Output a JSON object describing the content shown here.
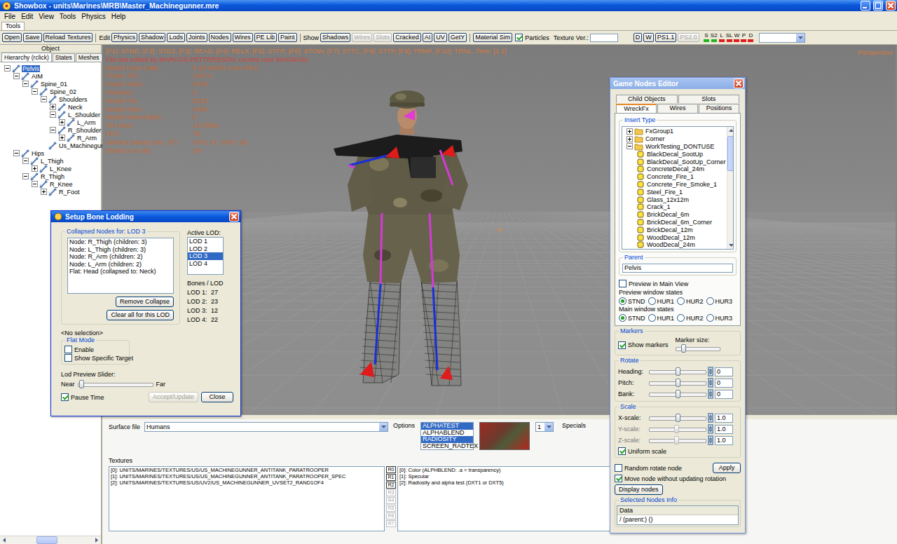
{
  "window": {
    "title": "Showbox - units\\Marines\\MRB\\Master_Machinegunner.mre"
  },
  "menu": [
    "File",
    "Edit",
    "View",
    "Tools",
    "Physics",
    "Help"
  ],
  "ribbon_tabs": [
    {
      "label": "Tools",
      "selected": true
    }
  ],
  "toolbar": {
    "file_buttons": [
      "Open",
      "Save",
      "Reload Textures"
    ],
    "edit_label": "Edit",
    "edit_buttons": [
      "Physics",
      "Shadow",
      "Lods",
      "Joints",
      "Nodes",
      "Wires",
      "PE Lib",
      "Paint"
    ],
    "show_label": "Show",
    "show_buttons": [
      {
        "label": "Shadows",
        "disabled": false
      },
      {
        "label": "Wires",
        "disabled": true
      },
      {
        "label": "Slots",
        "disabled": true
      },
      {
        "label": "Cracked",
        "disabled": false
      },
      {
        "label": "AI",
        "disabled": false
      },
      {
        "label": "UV",
        "disabled": false
      },
      {
        "label": "GetY",
        "disabled": false
      }
    ],
    "material_button": "Material Sim",
    "particles": {
      "label": "Particles",
      "checked": true
    },
    "texture_label": "Texture Ver.:",
    "shader_buttons": [
      {
        "label": "D",
        "disabled": false
      },
      {
        "label": "W",
        "disabled": false
      },
      {
        "label": "PS1.1",
        "disabled": false
      },
      {
        "label": "PS2.0",
        "disabled": true
      }
    ],
    "indicators": [
      {
        "label": "S",
        "color": "#1fb51f"
      },
      {
        "label": "S2",
        "color": "#1fb51f"
      },
      {
        "label": "L",
        "color": "#e01b1b"
      },
      {
        "label": "SL",
        "color": "#e01b1b"
      },
      {
        "label": "W",
        "color": "#e01b1b"
      },
      {
        "label": "P",
        "color": "#e01b1b"
      },
      {
        "label": "D",
        "color": "#e01b1b"
      }
    ]
  },
  "left_panel": {
    "header": "Object",
    "tabs": [
      {
        "label": "Hierarchy (rclick)",
        "selected": true
      },
      {
        "label": "States",
        "selected": false
      },
      {
        "label": "Meshes",
        "selected": false
      }
    ],
    "tree": [
      {
        "label": "Pelvis",
        "depth": 0,
        "kind": "node",
        "expanded": true,
        "selected": true
      },
      {
        "label": "AIM",
        "depth": 1,
        "kind": "node",
        "expanded": true,
        "selected": false
      },
      {
        "label": "Spine_01",
        "depth": 2,
        "kind": "node",
        "expanded": true,
        "selected": false
      },
      {
        "label": "Spine_02",
        "depth": 3,
        "kind": "node",
        "expanded": true,
        "selected": false
      },
      {
        "label": "Shoulders",
        "depth": 4,
        "kind": "node",
        "expanded": true,
        "selected": false
      },
      {
        "label": "Neck",
        "depth": 5,
        "kind": "node",
        "expanded": false,
        "selected": false
      },
      {
        "label": "L_Shoulder",
        "depth": 5,
        "kind": "node",
        "expanded": true,
        "selected": false
      },
      {
        "label": "L_Arm",
        "depth": 6,
        "kind": "node",
        "expanded": false,
        "selected": false
      },
      {
        "label": "R_Shoulder",
        "depth": 5,
        "kind": "node",
        "expanded": true,
        "selected": false
      },
      {
        "label": "R_Arm",
        "depth": 6,
        "kind": "node",
        "expanded": false,
        "selected": false
      },
      {
        "label": "Us_Machinegunner",
        "depth": 4,
        "kind": "leaf",
        "selected": false
      },
      {
        "label": "Hips",
        "depth": 1,
        "kind": "node",
        "expanded": true,
        "selected": false
      },
      {
        "label": "L_Thigh",
        "depth": 2,
        "kind": "node",
        "expanded": true,
        "selected": false
      },
      {
        "label": "L_Knee",
        "depth": 3,
        "kind": "node",
        "expanded": false,
        "selected": false
      },
      {
        "label": "R_Thigh",
        "depth": 2,
        "kind": "node",
        "expanded": true,
        "selected": false
      },
      {
        "label": "R_Knee",
        "depth": 3,
        "kind": "node",
        "expanded": true,
        "selected": false
      },
      {
        "label": "R_Foot",
        "depth": 4,
        "kind": "node",
        "expanded": false,
        "selected": false
      }
    ]
  },
  "viewport": {
    "keys_line": "[F1]: STND, [F2]: STD2, [F3]: READ, [F4]: RELX, [F5]: STFR, [F6]: STOW, [F7]: STTC, [F8]: STTP, [F9]: TRNR, [F10]: TRNL, Time: [1.2]",
    "edit_line": "File last edited by MARCUS PETTERSSON, current user MAGNUSL",
    "stats": [
      {
        "label": "Model Draw Calls:",
        "value": "5 (of which 0 are PEs)"
      },
      {
        "label": "Frame Tris:",
        "value": "10674"
      },
      {
        "label": "Frame Verts:",
        "value": "9780"
      },
      {
        "label": "Particles:",
        "value": "0"
      },
      {
        "label": "Model Tris:",
        "value": "5203"
      },
      {
        "label": "Model Verts:",
        "value": "4430"
      },
      {
        "label": "Model active lights:",
        "value": "0"
      },
      {
        "label": "Tex Mem:",
        "value": "12730kb"
      },
      {
        "label": "FPS:",
        "value": "78"
      },
      {
        "label": "Joints & Bones (tot.: 27):",
        "value": "CPU: 27, GPU: 26"
      },
      {
        "label": "Distance to obj:",
        "value": "3m"
      }
    ],
    "camera": "Perspective"
  },
  "bottom_panel": {
    "surface_label": "Surface file",
    "surface_value": "Humans",
    "options_label": "Options",
    "options": [
      {
        "label": "ALPHATEST",
        "selected": true
      },
      {
        "label": "ALPHABLEND",
        "selected": false
      },
      {
        "label": "RADIOSITY",
        "selected": true
      },
      {
        "label": "SCREEN_RADTEX",
        "selected": false
      }
    ],
    "lod_value": "1",
    "specials_label": "Specials",
    "textures_label": "Textures",
    "textures": [
      "[0]: UNITS/MARINES/TEXTURES/US/US_MACHINEGUNNER_ANTITANK_PARATROOPER",
      "[1]: UNITS/MARINES/TEXTURES/US/US_MACHINEGUNNER_ANTITANK_PARATROOPER_SPEC",
      "[2]: UNITS/MARINES/TEXTURES/US/UV2/US_MACHINEGUNNER_UVSET2_RAND1OF4"
    ],
    "slot_buttons": [
      {
        "label": "R0",
        "disabled": false
      },
      {
        "label": "R1",
        "disabled": false
      },
      {
        "label": "R2",
        "disabled": false
      },
      {
        "label": "R3",
        "disabled": true
      },
      {
        "label": "R4",
        "disabled": true
      },
      {
        "label": "R5",
        "disabled": true
      },
      {
        "label": "R6",
        "disabled": true
      },
      {
        "label": "R7",
        "disabled": true
      }
    ],
    "slot_descriptions": [
      "[0]: Color (ALPHBLEND: .a = transparency)",
      "[1]: Specular",
      "[2]: Radiosity and alpha test (DXT1 or DXT5)"
    ]
  },
  "bone_lodding": {
    "title": "Setup Bone Lodding",
    "collapsed_label": "Collapsed Nodes for: LOD 3",
    "collapsed_nodes": [
      "Node: R_Thigh (children: 3)",
      "Node: L_Thigh (children: 3)",
      "Node: R_Arm (children: 2)",
      "Node: L_Arm (children: 2)",
      "Flat: Head (collapsed to: Neck)"
    ],
    "remove_button": "Remove Collapse",
    "clear_button": "Clear all for this LOD",
    "active_lod_label": "Active LOD:",
    "lods": [
      {
        "label": "LOD 1",
        "selected": false
      },
      {
        "label": "LOD 2",
        "selected": false
      },
      {
        "label": "LOD 3",
        "selected": true
      },
      {
        "label": "LOD 4",
        "selected": false
      }
    ],
    "bones_label": "Bones / LOD",
    "bones": [
      {
        "label": "LOD 1:",
        "value": "27"
      },
      {
        "label": "LOD 2:",
        "value": "23"
      },
      {
        "label": "LOD 3:",
        "value": "12"
      },
      {
        "label": "LOD 4:",
        "value": "22"
      }
    ],
    "selection_text": "<No selection>",
    "flat_mode_label": "Flat Mode",
    "flat_enable": {
      "label": "Enable",
      "checked": false
    },
    "flat_target": {
      "label": "Show Specific Target",
      "checked": false
    },
    "slider_label": "Lod Preview Slider:",
    "near_label": "Near",
    "far_label": "Far",
    "slider_level": 0.02,
    "pause_time": {
      "label": "Pause Time",
      "checked": true
    },
    "accept_button": {
      "label": "Accept/Update",
      "disabled": true
    },
    "close_button": "Close"
  },
  "nodes_editor": {
    "title": "Game Nodes Editor",
    "tab_rows": [
      [
        {
          "label": "Child Objects",
          "selected": false
        },
        {
          "label": "Slots",
          "selected": false
        }
      ],
      [
        {
          "label": "WreckFx",
          "selected": true
        },
        {
          "label": "Wires",
          "selected": false
        },
        {
          "label": "Positions",
          "selected": false
        }
      ]
    ],
    "insert_label": "Insert Type",
    "insert_tree": [
      {
        "label": "FxGroup1",
        "depth": 0,
        "kind": "folder",
        "expanded": false
      },
      {
        "label": "Corner",
        "depth": 0,
        "kind": "folder",
        "expanded": false
      },
      {
        "label": "WorkTesting_DONTUSE",
        "depth": 0,
        "kind": "folder",
        "expanded": true
      },
      {
        "label": "BlackDecal_SootUp",
        "depth": 1,
        "kind": "item"
      },
      {
        "label": "BlackDecal_SootUp_Corner",
        "depth": 1,
        "kind": "item"
      },
      {
        "label": "ConcreteDecal_24m",
        "depth": 1,
        "kind": "item"
      },
      {
        "label": "Concrete_Fire_1",
        "depth": 1,
        "kind": "item"
      },
      {
        "label": "Concrete_Fire_Smoke_1",
        "depth": 1,
        "kind": "item"
      },
      {
        "label": "Steel_Fire_1",
        "depth": 1,
        "kind": "item"
      },
      {
        "label": "Glass_12x12m",
        "depth": 1,
        "kind": "item"
      },
      {
        "label": "Crack_1",
        "depth": 1,
        "kind": "item"
      },
      {
        "label": "BrickDecal_6m",
        "depth": 1,
        "kind": "item"
      },
      {
        "label": "BrickDecal_6m_Corner",
        "depth": 1,
        "kind": "item"
      },
      {
        "label": "BrickDecal_12m",
        "depth": 1,
        "kind": "item"
      },
      {
        "label": "WoodDecal_12m",
        "depth": 1,
        "kind": "item"
      },
      {
        "label": "WoodDecal_24m",
        "depth": 1,
        "kind": "item"
      }
    ],
    "parent_label": "Parent",
    "parent_value": "Pelvis",
    "preview_main": {
      "label": "Preview in Main View",
      "checked": false
    },
    "preview_states_label": "Preview window states",
    "preview_states": [
      {
        "label": "STND",
        "selected": true
      },
      {
        "label": "HUR1",
        "selected": false
      },
      {
        "label": "HUR2",
        "selected": false
      },
      {
        "label": "HUR3",
        "selected": false
      }
    ],
    "main_states_label": "Main window states",
    "main_states": [
      {
        "label": "STND",
        "selected": true
      },
      {
        "label": "HUR1",
        "selected": false
      },
      {
        "label": "HUR2",
        "selected": false
      },
      {
        "label": "HUR3",
        "selected": false
      }
    ],
    "markers_label": "Markers",
    "show_markers": {
      "label": "Show markers",
      "checked": true
    },
    "marker_size_label": "Marker size:",
    "marker_size_level": 0.15,
    "rotate_label": "Rotate",
    "rotate": [
      {
        "label": "Heading:",
        "level": 0.5,
        "value": "0"
      },
      {
        "label": "Pitch:",
        "level": 0.5,
        "value": "0"
      },
      {
        "label": "Bank:",
        "level": 0.5,
        "value": "0"
      }
    ],
    "scale_label": "Scale",
    "scale": [
      {
        "label": "X-scale:",
        "level": 0.5,
        "value": "1.0",
        "disabled": false
      },
      {
        "label": "Y-scale:",
        "level": 0.48,
        "value": "1.0",
        "disabled": true
      },
      {
        "label": "Z-scale:",
        "level": 0.48,
        "value": "1.0",
        "disabled": true
      }
    ],
    "uniform_scale": {
      "label": "Uniform scale",
      "checked": true
    },
    "random_rotate": {
      "label": "Random rotate node",
      "checked": false
    },
    "apply_button": "Apply",
    "move_node": {
      "label": "Move node without updating rotation",
      "checked": true
    },
    "display_button": "Display nodes",
    "info_label": "Selected Nodes Info",
    "info_header": "Data",
    "info_rows": [
      "/ (parent:) ()"
    ]
  }
}
